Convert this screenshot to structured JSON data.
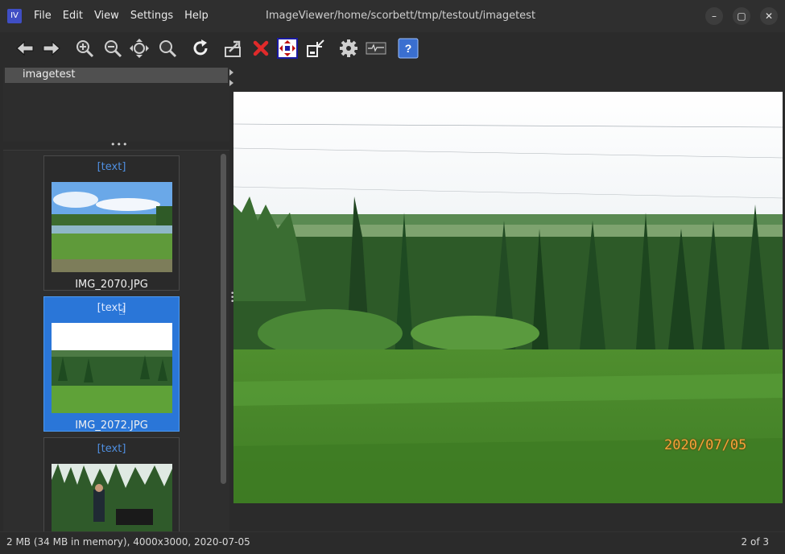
{
  "app": {
    "icon_text": "IV",
    "window_title": "ImageViewer/home/scorbett/tmp/testout/imagetest"
  },
  "menu": [
    "File",
    "Edit",
    "View",
    "Settings",
    "Help"
  ],
  "window_controls": {
    "minimize": "–",
    "maximize": "▢",
    "close": "✕"
  },
  "toolbar": {
    "icons": [
      "back-arrow-icon",
      "forward-arrow-icon",
      "zoom-in-icon",
      "zoom-out-icon",
      "fit-window-icon",
      "zoom-original-icon",
      "reload-icon",
      "export-icon",
      "delete-icon",
      "fullscreen-icon",
      "external-window-icon",
      "settings-icon",
      "monitor-icon",
      "help-icon"
    ],
    "help_label": "?"
  },
  "tree": {
    "root_label": "imagetest"
  },
  "splitter_dots": "•••",
  "thumbnails": [
    {
      "caption": "[text]",
      "name": "IMG_2070.JPG",
      "selected": false
    },
    {
      "caption": "[text]",
      "name": "IMG_2072.JPG",
      "selected": true
    },
    {
      "caption": "[text]",
      "name": "",
      "selected": false
    }
  ],
  "viewer": {
    "date_stamp": "2020/07/05"
  },
  "status": {
    "info": "2 MB (34 MB in memory), 4000x3000, 2020-07-05",
    "position": "2 of 3"
  },
  "colors": {
    "accent": "#2a76d8",
    "caption_link": "#4f8fe0",
    "date_stamp": "#f5a33a"
  }
}
